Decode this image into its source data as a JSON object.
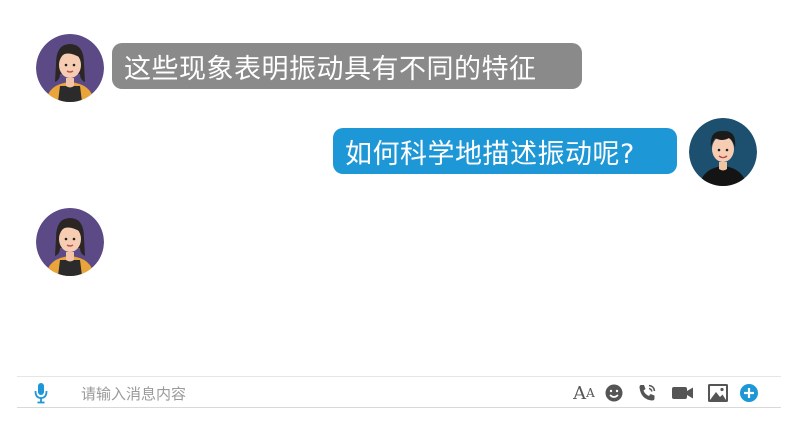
{
  "messages": [
    {
      "side": "left",
      "text": "这些现象表明振动具有不同的特征",
      "avatar": "female-avatar"
    },
    {
      "side": "right",
      "text": "如何科学地描述振动呢?",
      "avatar": "male-avatar"
    },
    {
      "side": "left",
      "text": "",
      "avatar": "female-avatar"
    }
  ],
  "input": {
    "placeholder": "请输入消息内容",
    "tools": [
      "font-size-icon",
      "emoji-icon",
      "phone-call-icon",
      "video-call-icon",
      "image-icon",
      "add-icon"
    ],
    "font_glyph_big": "A",
    "font_glyph_small": "A"
  },
  "colors": {
    "left_bubble": "#8a8a8a",
    "right_bubble": "#1e97d6",
    "accent": "#1e97d6",
    "female_avatar_bg": "#5b4a86",
    "male_avatar_bg": "#1d4f6f"
  }
}
